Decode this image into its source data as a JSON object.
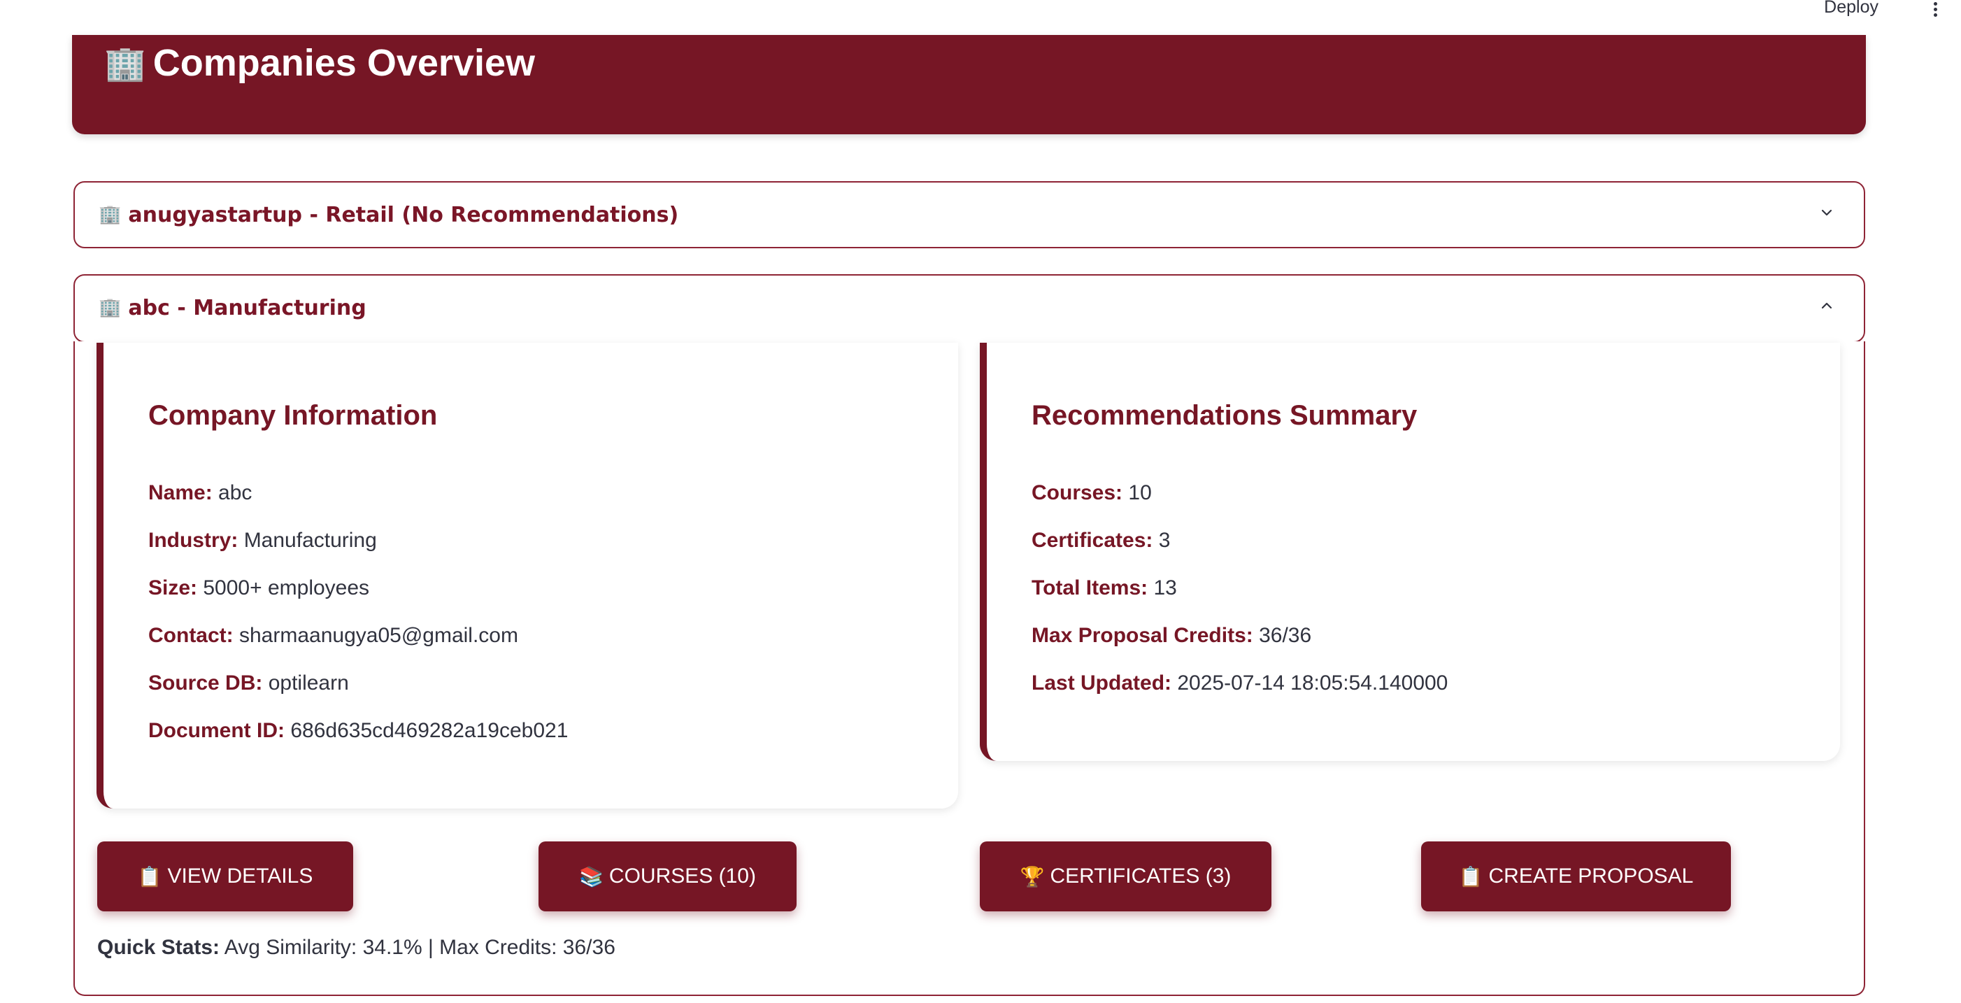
{
  "topbar": {
    "deploy_label": "Deploy"
  },
  "header": {
    "icon": "building-icon",
    "icon_glyph": "🏢",
    "title": "Companies Overview"
  },
  "companies": [
    {
      "icon_glyph": "🏢",
      "title": "anugyastartup - Retail (No Recommendations)",
      "expanded": false
    },
    {
      "icon_glyph": "🏢",
      "title": "abc - Manufacturing",
      "expanded": true
    }
  ],
  "company_info": {
    "heading": "Company Information",
    "name_label": "Name:",
    "name": "abc",
    "industry_label": "Industry:",
    "industry": "Manufacturing",
    "size_label": "Size:",
    "size": "5000+ employees",
    "contact_label": "Contact:",
    "contact": "sharmaanugya05@gmail.com",
    "source_label": "Source DB:",
    "source": "optilearn",
    "docid_label": "Document ID:",
    "docid": "686d635cd469282a19ceb021"
  },
  "recommendations": {
    "heading": "Recommendations Summary",
    "courses_label": "Courses:",
    "courses": "10",
    "certificates_label": "Certificates:",
    "certificates": "3",
    "total_label": "Total Items:",
    "total": "13",
    "credits_label": "Max Proposal Credits:",
    "credits": "36/36",
    "updated_label": "Last Updated:",
    "updated": "2025-07-14 18:05:54.140000"
  },
  "actions": {
    "view_details": {
      "icon_glyph": "📋",
      "label": "VIEW DETAILS"
    },
    "courses": {
      "icon_glyph": "📚",
      "label": "COURSES (10)"
    },
    "certificates": {
      "icon_glyph": "🏆",
      "label": "CERTIFICATES (3)"
    },
    "create_proposal": {
      "icon_glyph": "📋",
      "label": "CREATE PROPOSAL"
    }
  },
  "quick_stats": {
    "label": "Quick Stats:",
    "text": " Avg Similarity: 34.1% | Max Credits: 36/36"
  },
  "colors": {
    "brand": "#761625",
    "text": "#31333f",
    "background": "#ffffff"
  }
}
